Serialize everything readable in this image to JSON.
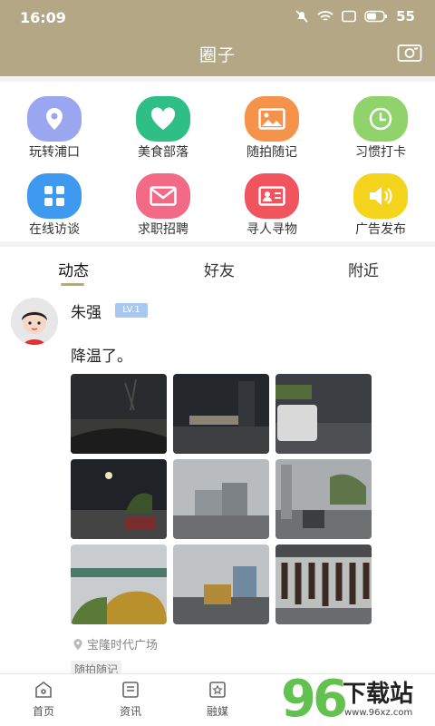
{
  "status_bar": {
    "time": "16:09",
    "battery": "55"
  },
  "header": {
    "title": "圈子"
  },
  "grid": [
    {
      "label": "玩转浦口",
      "color": "#9aa6f0",
      "icon": "location-pin-icon"
    },
    {
      "label": "美食部落",
      "color": "#2fbf86",
      "icon": "heart-icon"
    },
    {
      "label": "随拍随记",
      "color": "#f5934a",
      "icon": "picture-icon"
    },
    {
      "label": "习惯打卡",
      "color": "#8fd36a",
      "icon": "clock-icon"
    },
    {
      "label": "在线访谈",
      "color": "#3d9af0",
      "icon": "grid-icon"
    },
    {
      "label": "求职招聘",
      "color": "#f26a86",
      "icon": "mail-icon"
    },
    {
      "label": "寻人寻物",
      "color": "#f2545d",
      "icon": "id-card-icon"
    },
    {
      "label": "广告发布",
      "color": "#f5d41e",
      "icon": "speaker-icon"
    }
  ],
  "tabs": [
    "动态",
    "好友",
    "附近"
  ],
  "post": {
    "author": "朱强",
    "level": "LV.1",
    "text": "降温了。",
    "location": "宝隆时代广场",
    "tag": "随拍随记"
  },
  "bottom_nav": [
    {
      "label": "首页",
      "icon": "home-icon"
    },
    {
      "label": "资讯",
      "icon": "news-icon"
    },
    {
      "label": "融媒",
      "icon": "media-icon"
    }
  ],
  "watermark": {
    "number": "96",
    "text": "下载站",
    "url": "www.96xz.com"
  }
}
